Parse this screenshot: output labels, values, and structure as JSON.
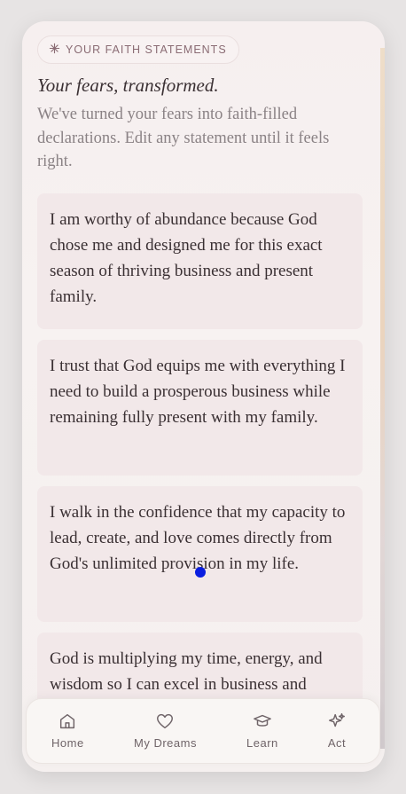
{
  "badge": {
    "label": "YOUR FAITH STATEMENTS",
    "icon": "sparkle-icon"
  },
  "heading": {
    "subtitle": "Your fears, transformed."
  },
  "intro": "We've turned your fears into faith-filled declarations. Edit any statement until it feels right.",
  "statements": [
    "I am worthy of abundance because God chose me and designed me for this exact season of thriving business and present family.",
    "I trust that God equips me with everything I need to build a prosperous business while remaining fully present with my family.",
    "I walk in the confidence that my capacity to lead, create, and love comes directly from God's unlimited provision in my life.",
    "God is multiplying my time, energy, and wisdom so I can excel in business and"
  ],
  "tabs": [
    {
      "label": "Home",
      "icon": "home-icon"
    },
    {
      "label": "My Dreams",
      "icon": "heart-icon"
    },
    {
      "label": "Learn",
      "icon": "graduation-cap-icon"
    },
    {
      "label": "Act",
      "icon": "sparkles-icon"
    }
  ],
  "colors": {
    "accent": "#8a6c74",
    "card": "#f2e8e9",
    "text": "#3a3033"
  }
}
